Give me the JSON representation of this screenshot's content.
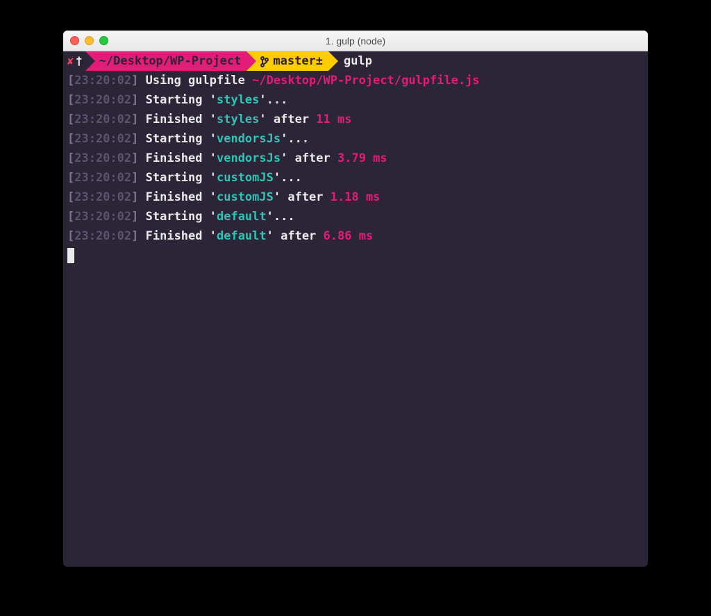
{
  "window": {
    "title": "1. gulp (node)"
  },
  "prompt": {
    "path": "~/Desktop/WP-Project",
    "branch": "master±",
    "command": "gulp"
  },
  "colors": {
    "magenta": "#e31c79",
    "cyan": "#2ec4b6",
    "yellow": "#ffcc00",
    "bg": "#2c2538",
    "ts_bracket": "#7d7791",
    "ts_time": "#5a5470",
    "fg": "#eaeaea"
  },
  "log": [
    {
      "ts": "23:20:02",
      "parts": [
        {
          "text": "Using gulpfile ",
          "cls": "white"
        },
        {
          "text": "~/Desktop/WP-Project/gulpfile.js",
          "cls": "magenta"
        }
      ]
    },
    {
      "ts": "23:20:02",
      "parts": [
        {
          "text": "Starting '",
          "cls": "white"
        },
        {
          "text": "styles",
          "cls": "cyan"
        },
        {
          "text": "'...",
          "cls": "white"
        }
      ]
    },
    {
      "ts": "23:20:02",
      "parts": [
        {
          "text": "Finished '",
          "cls": "white"
        },
        {
          "text": "styles",
          "cls": "cyan"
        },
        {
          "text": "' after ",
          "cls": "white"
        },
        {
          "text": "11 ms",
          "cls": "magenta"
        }
      ]
    },
    {
      "ts": "23:20:02",
      "parts": [
        {
          "text": "Starting '",
          "cls": "white"
        },
        {
          "text": "vendorsJs",
          "cls": "cyan"
        },
        {
          "text": "'...",
          "cls": "white"
        }
      ]
    },
    {
      "ts": "23:20:02",
      "parts": [
        {
          "text": "Finished '",
          "cls": "white"
        },
        {
          "text": "vendorsJs",
          "cls": "cyan"
        },
        {
          "text": "' after ",
          "cls": "white"
        },
        {
          "text": "3.79 ms",
          "cls": "magenta"
        }
      ]
    },
    {
      "ts": "23:20:02",
      "parts": [
        {
          "text": "Starting '",
          "cls": "white"
        },
        {
          "text": "customJS",
          "cls": "cyan"
        },
        {
          "text": "'...",
          "cls": "white"
        }
      ]
    },
    {
      "ts": "23:20:02",
      "parts": [
        {
          "text": "Finished '",
          "cls": "white"
        },
        {
          "text": "customJS",
          "cls": "cyan"
        },
        {
          "text": "' after ",
          "cls": "white"
        },
        {
          "text": "1.18 ms",
          "cls": "magenta"
        }
      ]
    },
    {
      "ts": "23:20:02",
      "parts": [
        {
          "text": "Starting '",
          "cls": "white"
        },
        {
          "text": "default",
          "cls": "cyan"
        },
        {
          "text": "'...",
          "cls": "white"
        }
      ]
    },
    {
      "ts": "23:20:02",
      "parts": [
        {
          "text": "Finished '",
          "cls": "white"
        },
        {
          "text": "default",
          "cls": "cyan"
        },
        {
          "text": "' after ",
          "cls": "white"
        },
        {
          "text": "6.86 ms",
          "cls": "magenta"
        }
      ]
    }
  ]
}
